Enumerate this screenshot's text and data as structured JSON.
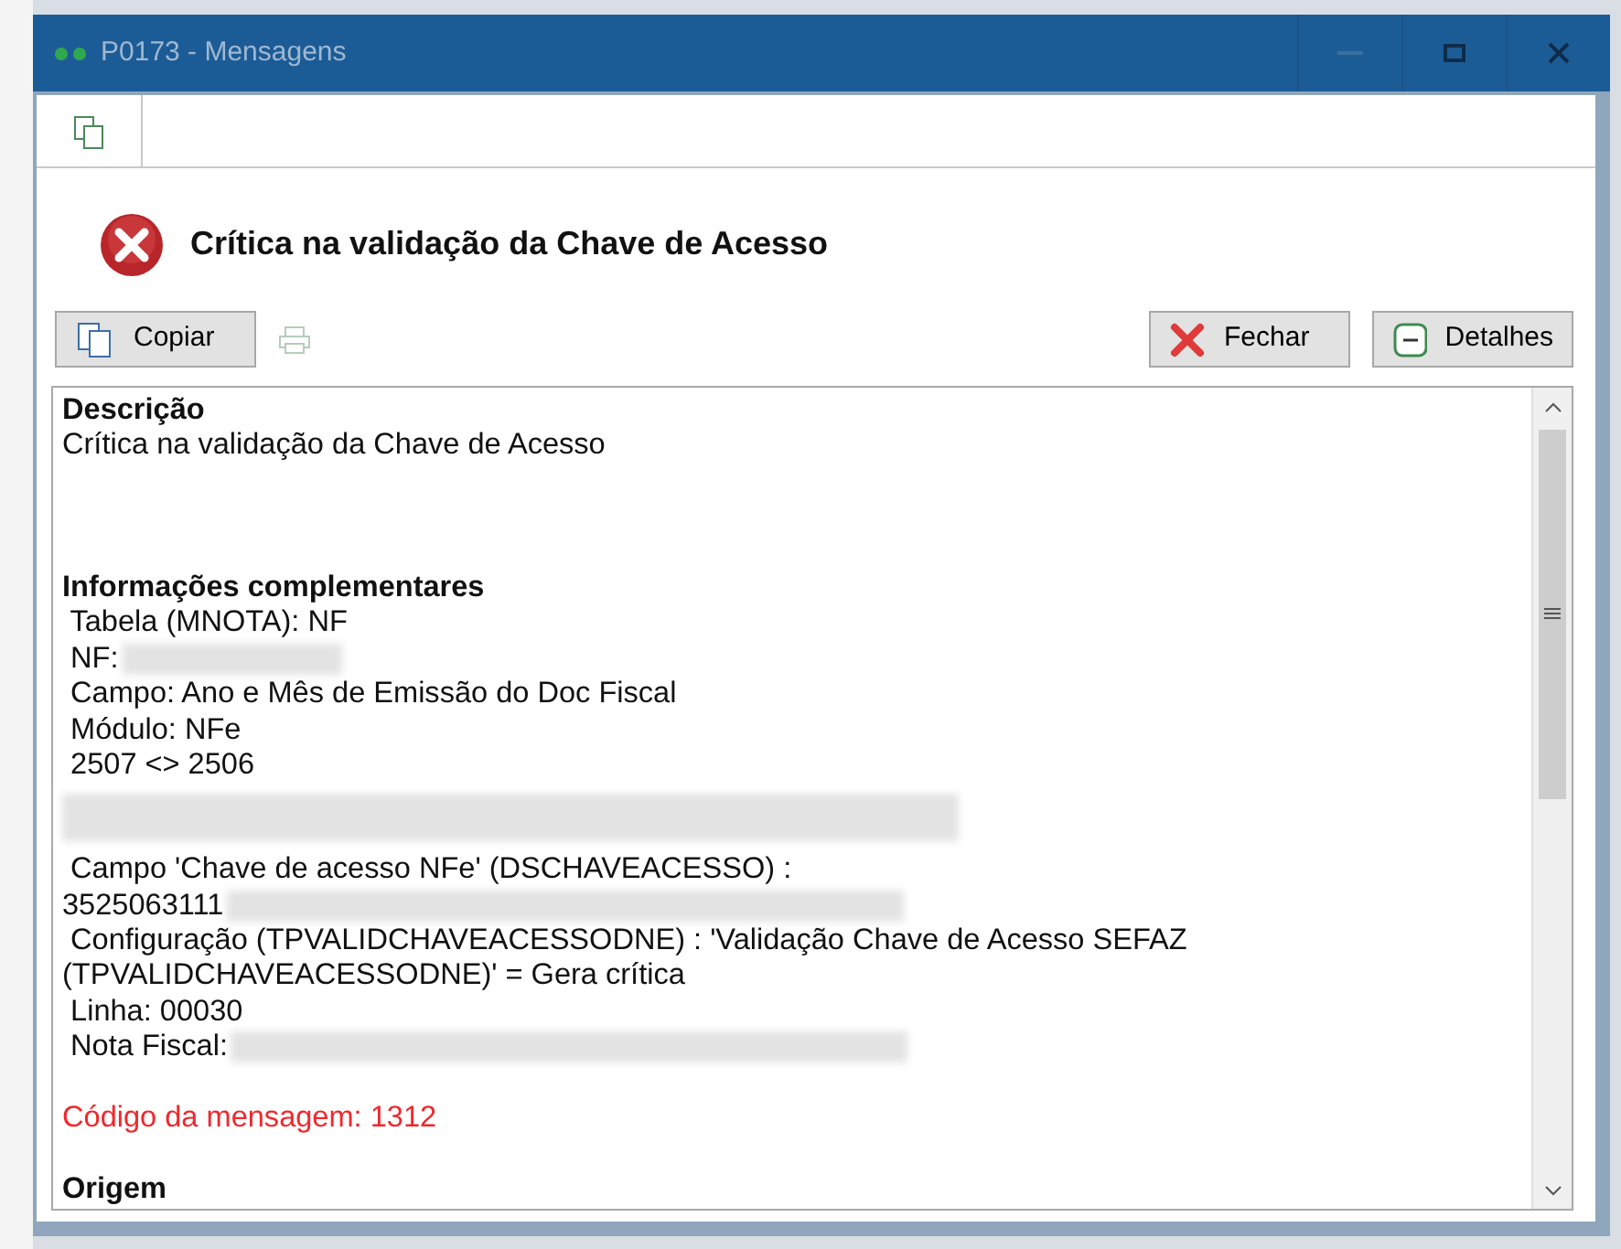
{
  "window": {
    "title": "P0173 - Mensagens"
  },
  "header": {
    "title": "Crítica na validação da Chave de Acesso"
  },
  "buttons": [
    {
      "label": "Copiar",
      "kind": "copy"
    },
    {
      "label": "Fechar",
      "kind": "close"
    },
    {
      "label": "Detalhes",
      "kind": "details"
    }
  ],
  "message_lines": [
    {
      "kind": "heading",
      "text": "Descrição"
    },
    {
      "kind": "text",
      "text": "Crítica na validação da Chave de Acesso"
    },
    {
      "kind": "blank"
    },
    {
      "kind": "blank"
    },
    {
      "kind": "blank"
    },
    {
      "kind": "heading",
      "text": "Informações complementares"
    },
    {
      "kind": "text",
      "text": " Tabela (MNOTA): NF"
    },
    {
      "kind": "text",
      "text": " NF:",
      "redacted": true
    },
    {
      "kind": "text",
      "text": " Campo: Ano e Mês de Emissão do Doc Fiscal"
    },
    {
      "kind": "text",
      "text": " Módulo: NFe"
    },
    {
      "kind": "text",
      "text": " 2507 <> 2506"
    },
    {
      "kind": "redacted"
    },
    {
      "kind": "text",
      "text": " Campo 'Chave de acesso NFe' (DSCHAVEACESSO) :"
    },
    {
      "kind": "text",
      "text": "3525063111",
      "redacted": true
    },
    {
      "kind": "text",
      "text": " Configuração (TPVALIDCHAVEACESSODNE) : 'Validação Chave de Acesso SEFAZ"
    },
    {
      "kind": "text",
      "text": "(TPVALIDCHAVEACESSODNE)' = Gera crítica"
    },
    {
      "kind": "text",
      "text": " Linha: 00030"
    },
    {
      "kind": "text",
      "text": " Nota Fiscal:",
      "redacted": true
    },
    {
      "kind": "blank"
    },
    {
      "kind": "error",
      "text": "Código da mensagem: 1312"
    },
    {
      "kind": "blank"
    },
    {
      "kind": "heading",
      "text": "Origem"
    }
  ]
}
